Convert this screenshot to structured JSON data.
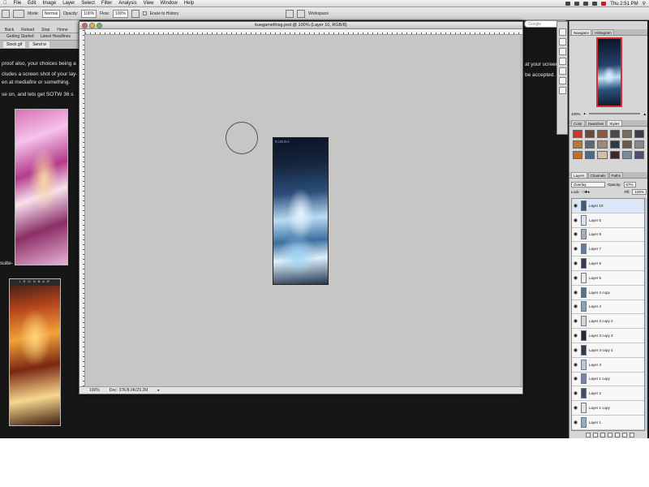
{
  "menubar": {
    "items": [
      "File",
      "Edit",
      "Image",
      "Layer",
      "Select",
      "Filter",
      "Analysis",
      "View",
      "Window",
      "Help"
    ],
    "clock": "Thu 2:51 PM"
  },
  "options_bar": {
    "mode_label": "Mode:",
    "mode_value": "Normal",
    "opacity_label": "Opacity:",
    "opacity_value": "100%",
    "flow_label": "Flow:",
    "flow_value": "100%",
    "erase_to_history": "Erase to History",
    "workspace_label": "Workspace"
  },
  "browser": {
    "toolbar": [
      "Back",
      "Reload",
      "Stop",
      "Home"
    ],
    "bookmarks": [
      "Getting Started",
      "Latest Headlines"
    ],
    "tabs": [
      "Stock gif",
      "Send w"
    ],
    "search_placeholder": "Google"
  },
  "web_text": {
    "line1": "proof also, your choices being a",
    "line2": "cludes a screen shot of your lay-",
    "line3": "en at mediafire or something.",
    "line4": "se on, and lets get SOTW 36 s",
    "line_right1": "at your screen",
    "line_right2": "be accepted.",
    "side_word": "suite-",
    "thumb2_header": "I R O N B A R"
  },
  "document": {
    "title": "kuegamethisg.psd @ 100% (Layer 10, RGB/8)",
    "art_label": "KUEGA",
    "zoom": "100%",
    "doc_info": "Doc: 37K/8.0K/29.2M"
  },
  "panels": {
    "navigator_tabs": [
      "Navigator",
      "Histogram"
    ],
    "nav_zoom": "100%",
    "swatch_tabs": [
      "Color",
      "Swatches",
      "Styles"
    ],
    "layers_tabs": [
      "Layers",
      "Channels",
      "Paths"
    ],
    "blend_mode": "Overlay",
    "opacity_label": "Opacity:",
    "opacity_value": "67%",
    "lock_label": "Lock:",
    "fill_label": "Fill:",
    "fill_value": "100%",
    "layers": [
      "Layer 10",
      "Layer 5",
      "Layer 8",
      "Layer 7",
      "Layer 6",
      "Layer 5",
      "Layer 4 copy",
      "Layer 4",
      "Layer 3 copy 2",
      "Layer 3 copy 3",
      "Layer 3 copy 4",
      "Layer 3",
      "Layer 1 copy",
      "Layer 2",
      "Layer 1 copy",
      "Layer 1"
    ]
  },
  "colors": {
    "swatches": [
      "#c83a2a",
      "#6b4a3a",
      "#8a5a3a",
      "#4a4a4a",
      "#7a6a5a",
      "#3a3a4a",
      "#b47a3a",
      "#5a6a7a",
      "#9a8a7a",
      "#2a3a4a",
      "#6a5a4a",
      "#8a8a8a",
      "#c0702a",
      "#4a6a8a",
      "#d0c0a0",
      "#3a2a2a",
      "#7a8a9a",
      "#5a4a6a"
    ],
    "layer_thumbs": [
      "#3a5a8a",
      "#cfe4f4",
      "#9ab0c8",
      "#5c7ea2",
      "#2b3d5a",
      "#e0ecf6",
      "#4d6f99",
      "#7fa4c8",
      "#c8d8e8",
      "#1c2a40",
      "#2a3c58",
      "#b0c8e0",
      "#6a8ab0",
      "#3a4e6e",
      "#d8e6f2",
      "#8eaccc"
    ]
  }
}
